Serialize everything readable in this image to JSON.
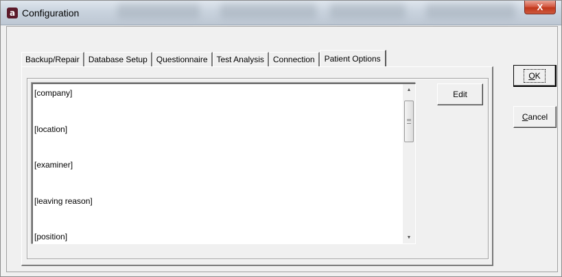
{
  "window": {
    "title": "Configuration",
    "close_glyph": "X",
    "app_icon_letter": "a"
  },
  "tabs": [
    {
      "label": "Backup/Repair",
      "active": false
    },
    {
      "label": "Database Setup",
      "active": false
    },
    {
      "label": "Questionnaire",
      "active": false
    },
    {
      "label": "Test Analysis",
      "active": false
    },
    {
      "label": "Connection",
      "active": false
    },
    {
      "label": "Patient Options",
      "active": true
    }
  ],
  "patient_options": {
    "list_items": [
      "[company]",
      "[location]",
      "[examiner]",
      "[leaving reason]",
      "[position]"
    ],
    "edit_label": "Edit"
  },
  "dialog_buttons": {
    "ok_mnemonic": "O",
    "ok_rest": "K",
    "cancel_mnemonic": "C",
    "cancel_rest": "ancel"
  },
  "icons": {
    "app": "app-logo-icon",
    "close": "close-icon",
    "scroll_up": "chevron-up-icon",
    "scroll_down": "chevron-down-icon"
  },
  "colors": {
    "close_button": "#c1381c",
    "app_icon": "#5b1a2a",
    "dialog_background": "#f0f0f0"
  }
}
